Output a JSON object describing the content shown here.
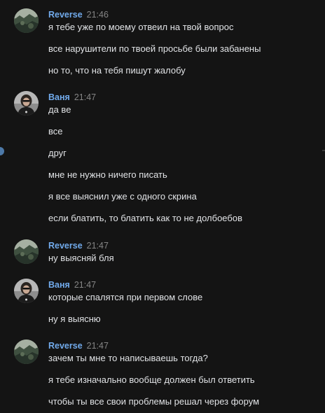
{
  "messages": [
    {
      "author": "Reverse",
      "time": "21:46",
      "avatar": "landscape-avatar",
      "lines": [
        "я тебе уже по моему отвеил на твой вопрос",
        "все нарушители по твоей просьбе были забанены",
        "но то, что на тебя пишут жалобу"
      ]
    },
    {
      "author": "Ваня",
      "time": "21:47",
      "avatar": "person-avatar",
      "lines": [
        "да ве",
        "все",
        "друг",
        "мне не нужно ничего писать",
        "я все выяснил уже с одного скрина",
        "если блатить, то блатить как то не долбоебов"
      ]
    },
    {
      "author": "Reverse",
      "time": "21:47",
      "avatar": "landscape-avatar",
      "lines": [
        "ну выясняй бля"
      ]
    },
    {
      "author": "Ваня",
      "time": "21:47",
      "avatar": "person-avatar",
      "lines": [
        "которые спалятся при первом слове",
        "ну я выясню"
      ]
    },
    {
      "author": "Reverse",
      "time": "21:47",
      "avatar": "landscape-avatar",
      "lines": [
        "зачем ты мне то написываешь тогда?",
        "я тебе изначально вообще должен был ответить",
        "чтобы ты все свои проблемы решал через форум"
      ]
    }
  ],
  "colors": {
    "background": "#141414",
    "author_link": "#71aaeb",
    "timestamp": "#858585",
    "message_text": "#e1e3e6"
  }
}
